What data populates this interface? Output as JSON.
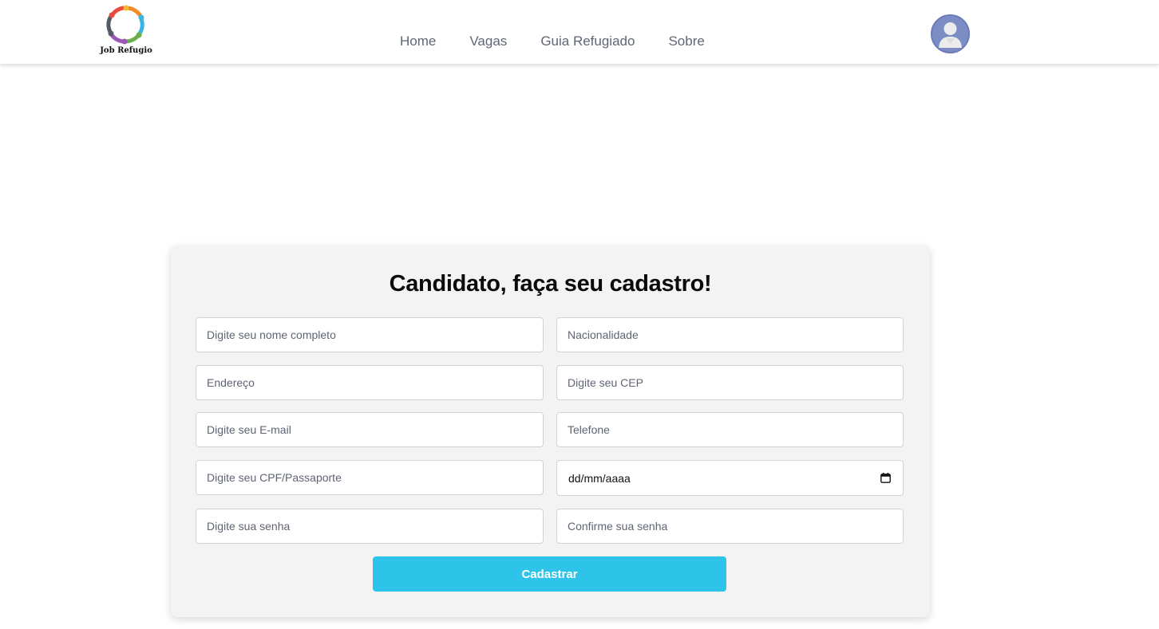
{
  "brand": {
    "name": "Job Refugio",
    "logo_icon": "people-circle-logo-icon"
  },
  "nav": {
    "links": [
      {
        "label": "Home"
      },
      {
        "label": "Vagas"
      },
      {
        "label": "Guia Refugiado"
      },
      {
        "label": "Sobre"
      }
    ]
  },
  "user": {
    "avatar_icon": "user-avatar-icon"
  },
  "form": {
    "title": "Candidato, faça seu cadastro!",
    "fields": {
      "nome": {
        "placeholder": "Digite seu nome completo",
        "value": ""
      },
      "nacionalidade": {
        "placeholder": "Nacionalidade",
        "value": ""
      },
      "endereco": {
        "placeholder": "Endereço",
        "value": ""
      },
      "cep": {
        "placeholder": "Digite seu CEP",
        "value": ""
      },
      "email": {
        "placeholder": "Digite seu E-mail",
        "value": ""
      },
      "telefone": {
        "placeholder": "Telefone",
        "value": ""
      },
      "documento": {
        "placeholder": "Digite seu CPF/Passaporte",
        "value": ""
      },
      "nascimento": {
        "display": "dd/mm/aaaa",
        "icon": "calendar-icon"
      },
      "senha": {
        "placeholder": "Digite sua senha",
        "value": ""
      },
      "confirmar_senha": {
        "placeholder": "Confirme sua senha",
        "value": ""
      }
    },
    "submit_label": "Cadastrar"
  },
  "colors": {
    "accent": "#2ec4ea",
    "card_bg": "#f3f3f3",
    "nav_text": "#5f6675",
    "avatar": "#7c8cc4"
  }
}
